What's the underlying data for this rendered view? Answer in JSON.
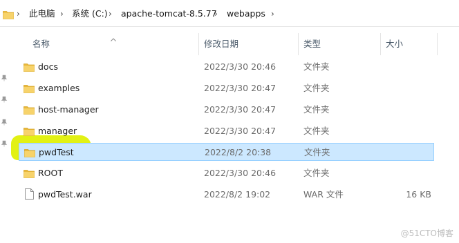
{
  "breadcrumb": {
    "items": [
      "此电脑",
      "系统 (C:)",
      "apache-tomcat-8.5.77",
      "webapps"
    ]
  },
  "columns": {
    "name": "名称",
    "modified": "修改日期",
    "type": "类型",
    "size": "大小"
  },
  "files": [
    {
      "name": "docs",
      "modified": "2022/3/30 20:46",
      "type": "文件夹",
      "size": "",
      "kind": "folder-icon",
      "selected": false
    },
    {
      "name": "examples",
      "modified": "2022/3/30 20:47",
      "type": "文件夹",
      "size": "",
      "kind": "folder-icon",
      "selected": false
    },
    {
      "name": "host-manager",
      "modified": "2022/3/30 20:47",
      "type": "文件夹",
      "size": "",
      "kind": "folder-icon",
      "selected": false
    },
    {
      "name": "manager",
      "modified": "2022/3/30 20:47",
      "type": "文件夹",
      "size": "",
      "kind": "folder-icon",
      "selected": false
    },
    {
      "name": "pwdTest",
      "modified": "2022/8/2 20:38",
      "type": "文件夹",
      "size": "",
      "kind": "folder-icon",
      "selected": true
    },
    {
      "name": "ROOT",
      "modified": "2022/3/30 20:46",
      "type": "文件夹",
      "size": "",
      "kind": "folder-icon",
      "selected": false
    },
    {
      "name": "pwdTest.war",
      "modified": "2022/8/2 19:02",
      "type": "WAR 文件",
      "size": "16 KB",
      "kind": "file-icon",
      "selected": false
    }
  ],
  "watermark": "@51CTO博客",
  "colors": {
    "selection_bg": "#cce8ff",
    "selection_border": "#99d1ff",
    "folder": "#f2c54a",
    "highlight_marker": "#dff000"
  }
}
